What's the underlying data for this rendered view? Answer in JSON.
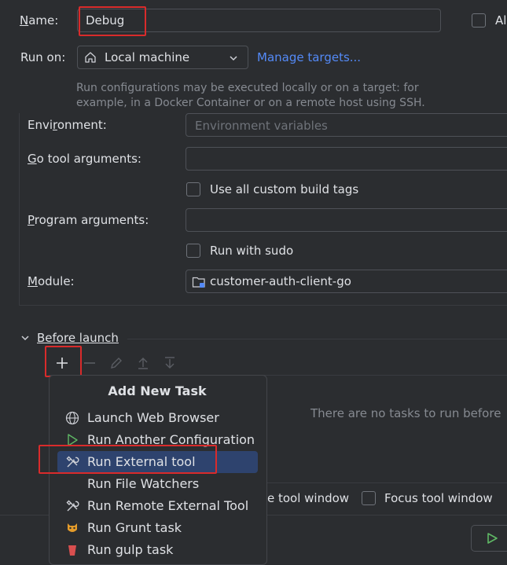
{
  "name_row": {
    "label": "Name:",
    "value": "Debug",
    "allow_checkbox_label": "Al"
  },
  "run_on": {
    "label": "Run on:",
    "target": "Local machine",
    "manage_link": "Manage targets...",
    "hint": [
      "Run configurations may be executed locally or on a target: for",
      "example, in a Docker Container or on a remote host using SSH."
    ]
  },
  "environment": {
    "label": "Environment:",
    "placeholder": "Environment variables"
  },
  "go_tool_args": {
    "label": "Go tool arguments:"
  },
  "custom_build_tags": {
    "label": "Use all custom build tags"
  },
  "program_args": {
    "label": "Program arguments:"
  },
  "run_with_sudo": {
    "label": "Run with sudo"
  },
  "module": {
    "label": "Module:",
    "value": "customer-auth-client-go"
  },
  "before_launch": {
    "label": "Before launch",
    "empty_text": "There are no tasks to run before"
  },
  "popup": {
    "title": "Add New Task",
    "items": [
      {
        "label": "Launch Web Browser",
        "icon": "globe-icon"
      },
      {
        "label": "Run Another Configuration",
        "icon": "play-icon"
      },
      {
        "label": "Run External tool",
        "icon": "tools-icon"
      },
      {
        "label": "Run File Watchers",
        "icon": "none"
      },
      {
        "label": "Run Remote External Tool",
        "icon": "tools-icon"
      },
      {
        "label": "Run Grunt task",
        "icon": "grunt-icon"
      },
      {
        "label": "Run gulp task",
        "icon": "gulp-icon"
      }
    ]
  },
  "bottom_options": {
    "show_tool_window": "e tool window",
    "focus_tool_window": "Focus tool window"
  },
  "colors": {
    "accent": "#548af7",
    "selection": "#2e436e",
    "highlight_box": "#d92b2b",
    "background": "#2b2d30"
  }
}
